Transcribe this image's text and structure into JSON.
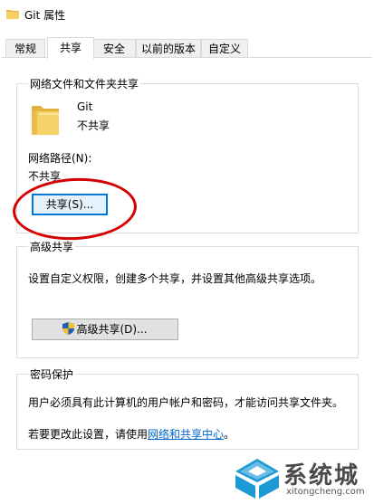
{
  "window": {
    "title": "Git 属性"
  },
  "tabs": [
    {
      "label": "常规"
    },
    {
      "label": "共享"
    },
    {
      "label": "安全"
    },
    {
      "label": "以前的版本"
    },
    {
      "label": "自定义"
    }
  ],
  "network_sharing": {
    "title": "网络文件和文件夹共享",
    "folder_name": "Git",
    "folder_status": "不共享",
    "path_label": "网络路径(N):",
    "path_value": "不共享",
    "share_button": "共享(S)..."
  },
  "advanced_sharing": {
    "title": "高级共享",
    "description": "设置自定义权限，创建多个共享，并设置其他高级共享选项。",
    "button": "高级共享(D)..."
  },
  "password_protection": {
    "title": "密码保护",
    "description": "用户必须具有此计算机的用户帐户和密码，才能访问共享文件夹。",
    "change_prefix": "若要更改此设置，请使用",
    "link": "网络和共享中心",
    "change_suffix": "。"
  },
  "watermark": {
    "main": "系统城",
    "sub": "xitongcheng.com"
  },
  "colors": {
    "accent": "#0078d7",
    "annotation_circle": "#d40000",
    "link": "#0066cc",
    "folder": "#f5c84a"
  }
}
